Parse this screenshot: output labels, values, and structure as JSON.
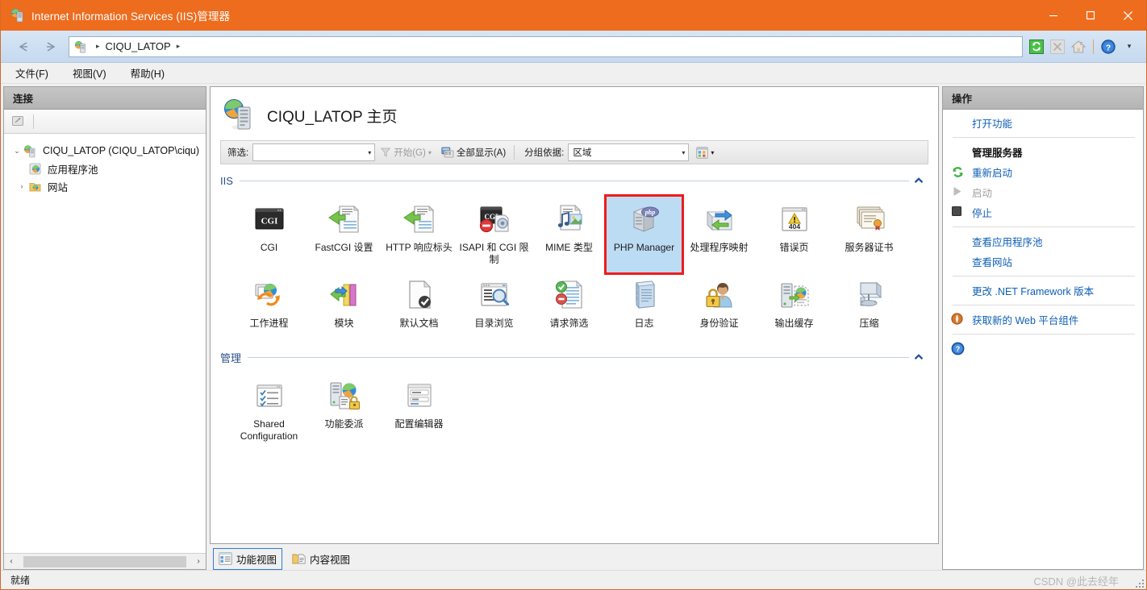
{
  "window": {
    "title": "Internet Information Services (IIS)管理器",
    "app_icon": "iis-server-icon",
    "controls": {
      "minimize": "—",
      "maximize": "☐",
      "close": "✕"
    },
    "titlebar_color": "#ED6C1E"
  },
  "addressbar": {
    "back_icon": "back-arrow-icon",
    "forward_icon": "forward-arrow-icon",
    "breadcrumb_icon": "server-icon",
    "breadcrumb": [
      "CIQU_LATOP"
    ],
    "separator": "▸",
    "tools": [
      {
        "name": "refresh-icon",
        "label": "刷新",
        "enabled": true
      },
      {
        "name": "stop-icon",
        "label": "停止",
        "enabled": false
      },
      {
        "name": "home-icon",
        "label": "主页",
        "enabled": true
      },
      {
        "name": "help-icon",
        "label": "帮助",
        "enabled": true
      }
    ],
    "tools_dropdown": "▾"
  },
  "menubar": {
    "items": [
      {
        "label": "文件(F)",
        "name": "menu-file"
      },
      {
        "label": "视图(V)",
        "name": "menu-view"
      },
      {
        "label": "帮助(H)",
        "name": "menu-help"
      }
    ]
  },
  "connections": {
    "header": "连接",
    "toolbar_icon": "connect-to-server-icon",
    "tree": [
      {
        "label": "CIQU_LATOP (CIQU_LATOP\\ciqu)",
        "level": 1,
        "twist": "⌄",
        "expanded": true,
        "icon": "server-icon"
      },
      {
        "label": "应用程序池",
        "level": 2,
        "twist": "",
        "icon": "app-pools-icon"
      },
      {
        "label": "网站",
        "level": 2,
        "twist": "›",
        "icon": "sites-folder-icon"
      }
    ],
    "hscroll": {
      "left": "‹",
      "right": "›"
    }
  },
  "main": {
    "page_title": "CIQU_LATOP 主页",
    "page_icon": "server-icon",
    "filter": {
      "label": "筛选:",
      "value": "",
      "placeholder": "",
      "dropdown_caret": "▾",
      "go_label": "开始(G)",
      "go_icon": "funnel-icon",
      "go_caret": "▾",
      "showall_label": "全部显示(A)",
      "showall_icon": "show-all-icon",
      "groupby_label": "分组依据:",
      "groupby_value": "区域",
      "groupby_caret": "▾",
      "viewmode_icon": "view-mode-icon",
      "viewmode_caret": "▾"
    },
    "sections": [
      {
        "name": "IIS",
        "collapse_icon": "chevron-up-icon",
        "items": [
          {
            "label": "CGI",
            "icon": "cgi-icon",
            "selected": false
          },
          {
            "label": "FastCGI 设置",
            "icon": "fastcgi-settings-icon",
            "selected": false
          },
          {
            "label": "HTTP 响应标头",
            "icon": "http-response-headers-icon",
            "selected": false
          },
          {
            "label": "ISAPI 和 CGI 限制",
            "icon": "isapi-cgi-restrictions-icon",
            "selected": false
          },
          {
            "label": "MIME 类型",
            "icon": "mime-types-icon",
            "selected": false
          },
          {
            "label": "PHP Manager",
            "icon": "php-manager-icon",
            "selected": true,
            "annotated": true
          },
          {
            "label": "处理程序映射",
            "icon": "handler-mappings-icon",
            "selected": false
          },
          {
            "label": "错误页",
            "icon": "error-pages-icon",
            "selected": false
          },
          {
            "label": "服务器证书",
            "icon": "server-certificates-icon",
            "selected": false
          },
          {
            "label": "工作进程",
            "icon": "worker-processes-icon",
            "selected": false
          },
          {
            "label": "模块",
            "icon": "modules-icon",
            "selected": false
          },
          {
            "label": "默认文档",
            "icon": "default-document-icon",
            "selected": false
          },
          {
            "label": "目录浏览",
            "icon": "directory-browsing-icon",
            "selected": false
          },
          {
            "label": "请求筛选",
            "icon": "request-filtering-icon",
            "selected": false
          },
          {
            "label": "日志",
            "icon": "logging-icon",
            "selected": false
          },
          {
            "label": "身份验证",
            "icon": "authentication-icon",
            "selected": false
          },
          {
            "label": "输出缓存",
            "icon": "output-caching-icon",
            "selected": false
          },
          {
            "label": "压缩",
            "icon": "compression-icon",
            "selected": false
          }
        ]
      },
      {
        "name": "管理",
        "collapse_icon": "chevron-up-icon",
        "items": [
          {
            "label": "Shared Configuration",
            "icon": "shared-configuration-icon",
            "selected": false
          },
          {
            "label": "功能委派",
            "icon": "feature-delegation-icon",
            "selected": false
          },
          {
            "label": "配置编辑器",
            "icon": "configuration-editor-icon",
            "selected": false
          }
        ]
      }
    ],
    "view_tabs": [
      {
        "label": "功能视图",
        "icon": "features-view-icon",
        "active": true
      },
      {
        "label": "内容视图",
        "icon": "content-view-icon",
        "active": false
      }
    ]
  },
  "actions": {
    "header": "操作",
    "items": [
      {
        "label": "打开功能",
        "icon": "",
        "type": "link"
      },
      {
        "type": "separator"
      },
      {
        "label": "管理服务器",
        "icon": "",
        "type": "header"
      },
      {
        "label": "重新启动",
        "icon": "restart-icon",
        "type": "link"
      },
      {
        "label": "启动",
        "icon": "start-icon",
        "type": "disabled"
      },
      {
        "label": "停止",
        "icon": "stop-square-icon",
        "type": "link"
      },
      {
        "type": "separator"
      },
      {
        "label": "查看应用程序池",
        "icon": "",
        "type": "link"
      },
      {
        "label": "查看网站",
        "icon": "",
        "type": "link"
      },
      {
        "type": "separator"
      },
      {
        "label": "更改 .NET Framework 版本",
        "icon": "",
        "type": "link"
      },
      {
        "type": "separator"
      },
      {
        "label": "获取新的 Web 平台组件",
        "icon": "web-platform-icon",
        "type": "link"
      },
      {
        "type": "separator"
      },
      {
        "label": "帮助",
        "icon": "help-circle-icon",
        "type": "link"
      }
    ]
  },
  "statusbar": {
    "text": "就绪",
    "watermark": "CSDN @此去经年"
  }
}
